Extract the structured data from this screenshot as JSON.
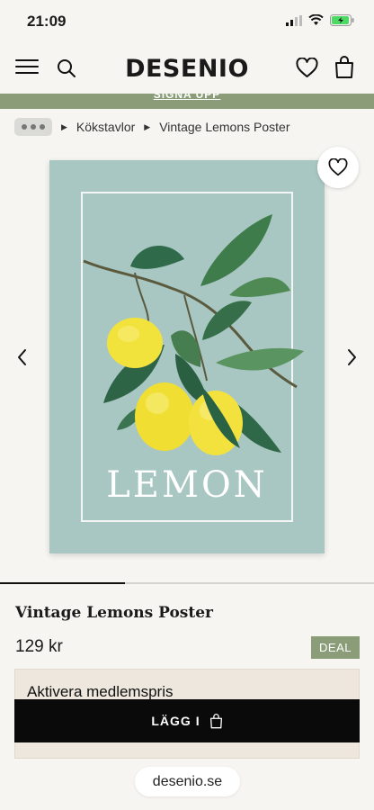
{
  "status": {
    "time": "21:09"
  },
  "header": {
    "logo": "DESENIO"
  },
  "promo": {
    "text": "SIGNA UPP"
  },
  "breadcrumb": {
    "items": [
      "Kökstavlor",
      "Vintage Lemons Poster"
    ]
  },
  "poster": {
    "title": "LEMON",
    "background": "#a9c7c2"
  },
  "gallery": {
    "progress": 0.335
  },
  "product": {
    "title": "Vintage Lemons Poster",
    "price": "129 kr",
    "badge": "DEAL"
  },
  "member": {
    "title": "Aktivera medlemspris"
  },
  "cart": {
    "label": "LÄGG I"
  },
  "browser": {
    "url": "desenio.se"
  },
  "colors": {
    "accent": "#8a9d78",
    "background": "#f6f5f1",
    "cta": "#0a0a0a"
  }
}
